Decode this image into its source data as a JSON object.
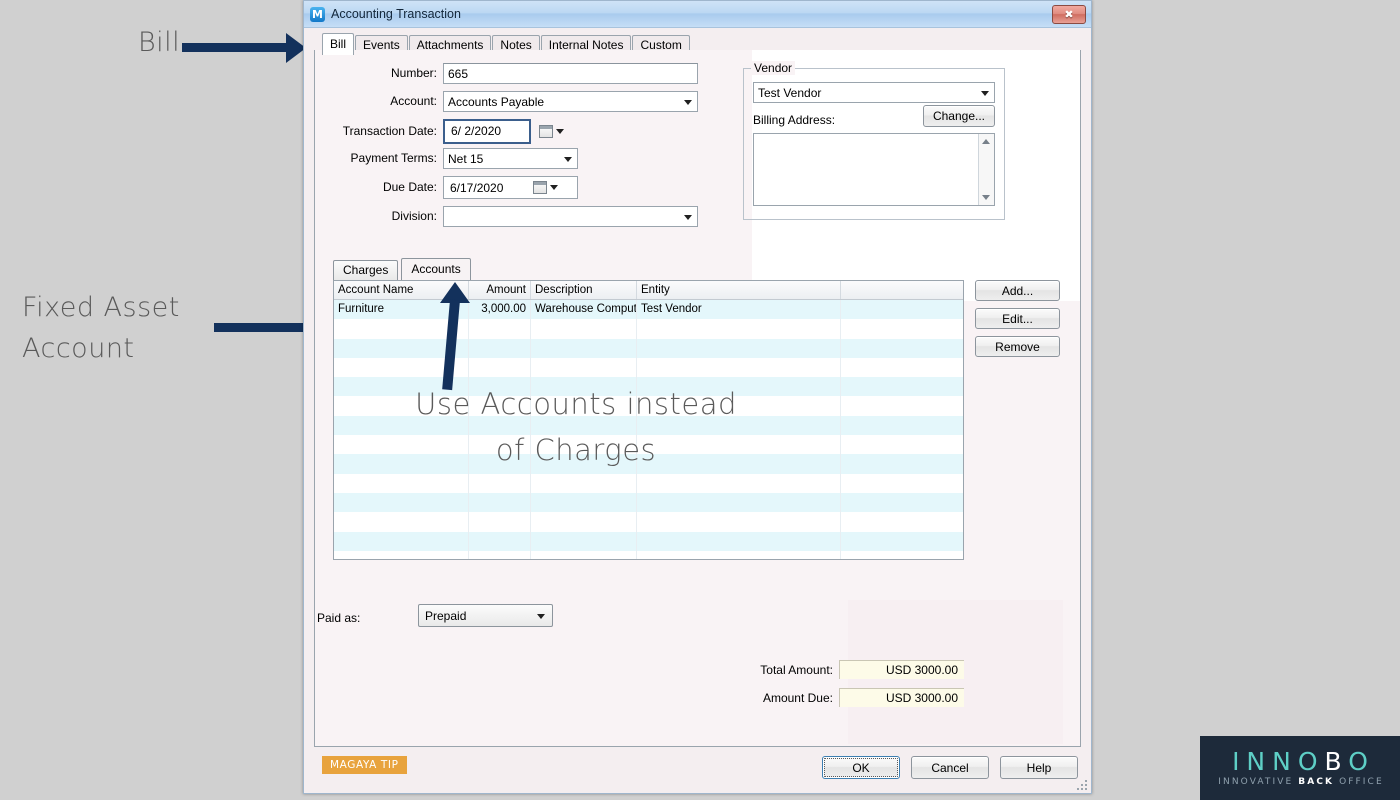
{
  "window": {
    "title": "Accounting Transaction",
    "logo_letter": "M",
    "close_label": "✖"
  },
  "tabs": [
    {
      "label": "Bill",
      "active": true
    },
    {
      "label": "Events",
      "active": false
    },
    {
      "label": "Attachments",
      "active": false
    },
    {
      "label": "Notes",
      "active": false
    },
    {
      "label": "Internal Notes",
      "active": false
    },
    {
      "label": "Custom",
      "active": false
    }
  ],
  "form": {
    "number": {
      "label": "Number:",
      "value": "665"
    },
    "account": {
      "label": "Account:",
      "value": "Accounts Payable"
    },
    "transaction_date": {
      "label": "Transaction Date:",
      "value": "6/  2/2020"
    },
    "payment_terms": {
      "label": "Payment Terms:",
      "value": "Net 15"
    },
    "due_date": {
      "label": "Due Date:",
      "value": "6/17/2020"
    },
    "division": {
      "label": "Division:",
      "value": ""
    }
  },
  "vendor": {
    "legend": "Vendor",
    "name": "Test Vendor",
    "billing_address_label": "Billing Address:",
    "change_button": "Change...",
    "billing_address_value": ""
  },
  "subtabs": [
    {
      "label": "Charges",
      "active": false
    },
    {
      "label": "Accounts",
      "active": true
    }
  ],
  "grid": {
    "columns": [
      "Account Name",
      "Amount",
      "Description",
      "Entity",
      ""
    ],
    "rows": [
      [
        "Furniture",
        "3,000.00",
        "Warehouse Comput",
        "Test Vendor",
        ""
      ],
      [
        "",
        "",
        "",
        "",
        ""
      ],
      [
        "",
        "",
        "",
        "",
        ""
      ],
      [
        "",
        "",
        "",
        "",
        ""
      ],
      [
        "",
        "",
        "",
        "",
        ""
      ],
      [
        "",
        "",
        "",
        "",
        ""
      ],
      [
        "",
        "",
        "",
        "",
        ""
      ],
      [
        "",
        "",
        "",
        "",
        ""
      ],
      [
        "",
        "",
        "",
        "",
        ""
      ],
      [
        "",
        "",
        "",
        "",
        ""
      ],
      [
        "",
        "",
        "",
        "",
        ""
      ],
      [
        "",
        "",
        "",
        "",
        ""
      ],
      [
        "",
        "",
        "",
        "",
        ""
      ],
      [
        "",
        "",
        "",
        "",
        ""
      ]
    ]
  },
  "grid_buttons": {
    "add": "Add...",
    "edit": "Edit...",
    "remove": "Remove"
  },
  "bottom": {
    "paid_as_label": "Paid as:",
    "paid_as_value": "Prepaid",
    "total_amount_label": "Total Amount:",
    "total_amount_value": "USD 3000.00",
    "amount_due_label": "Amount Due:",
    "amount_due_value": "USD 3000.00"
  },
  "footer": {
    "tip_badge": "MAGAYA TIP",
    "ok": "OK",
    "cancel": "Cancel",
    "help": "Help"
  },
  "annotations": {
    "bill": "Bill",
    "fixed_asset": "Fixed Asset\nAccount",
    "use_accounts_line1": "Use Accounts instead",
    "use_accounts_line2": "of Charges"
  },
  "branding": {
    "name_part1": "INNOB",
    "name_white": "B",
    "name_prefix": "INNO",
    "name_suffix": "O",
    "tagline_pre": "INNOVATIVE ",
    "tagline_white": "BACK",
    "tagline_post": " OFFICE"
  },
  "colors": {
    "annotation": "#5a5a5a",
    "arrow": "#13315c",
    "accent_teal": "#5ecfc6",
    "brand_dark": "#1d2a3a",
    "tip_orange": "#e8a33d",
    "row_alt": "#e4f7fb",
    "money_field": "#fdfbe8"
  }
}
